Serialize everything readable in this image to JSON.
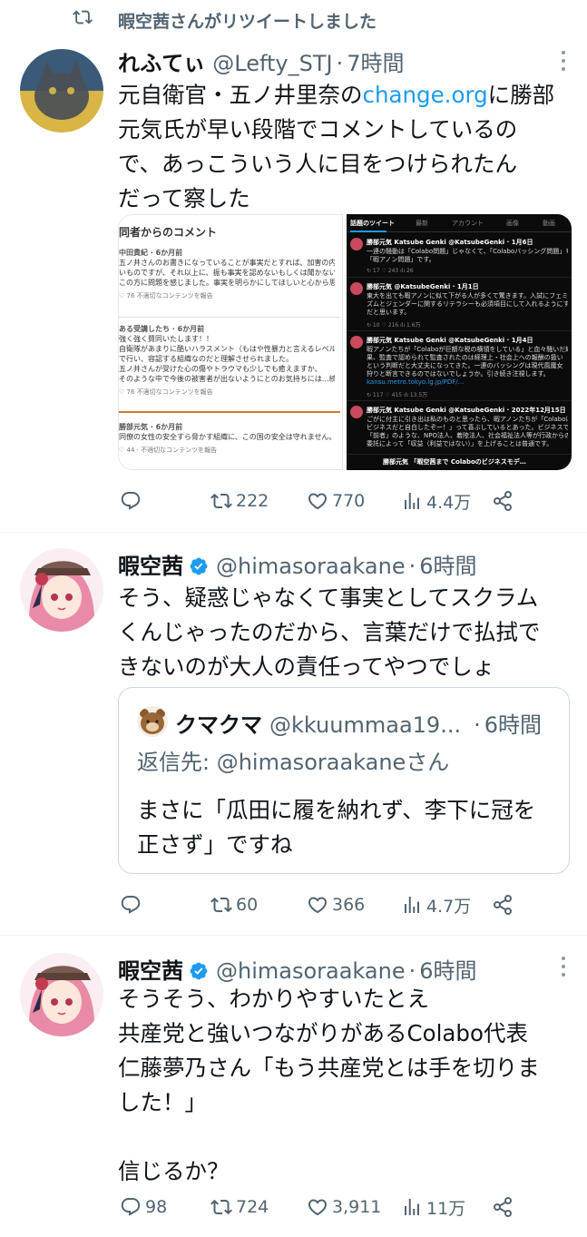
{
  "retweet_banner": {
    "text": "暇空茜さんがリツイートしました"
  },
  "tweets": [
    {
      "name": "れふてぃ",
      "handle": "@Lefty_STJ",
      "separator": "·",
      "time": "7時間",
      "text_before_link": "元自衛官・五ノ井里奈の",
      "link": "change.org",
      "text_after_link": "に勝部\n元気氏が早い段階でコメントしているの\nで、あっこういう人に目をつけられたん\nだって察した",
      "media": {
        "left": {
          "title": "同者からのコメント",
          "comments": [
            {
              "author": "中田貴紀 · 6か月前",
              "lines": [
                "五ノ井さんのお書きになっていることが事実だとすれば、加害の内容もひど",
                "いものですが、それ以上に、振も事実を認めないもしくは聞かないという",
                "この方に問題を感じました。事実を明らかにしてほしいと心から思います。"
              ],
              "meta": "♡ 76   不適切なコンテンツを報告"
            },
            {
              "author": "ある受講したち · 6か月前",
              "lines": [
                "強く強く賛同いたします！！",
                "自衛隊があまりに酷いハラスメント（もはや性暴力と言えるレベル）を平気",
                "で行い、容認する組織なのだと理解させられました。",
                "五ノ井さんが受けた心の傷やトラウマも少しでも癒えますか、",
                "そのような中で今後の被害者が出ないようにとのお気持ちには…続きを読む"
              ],
              "meta": "♡ 76   不適切なコンテンツを報告"
            },
            {
              "author": "勝部元気 · 6か月前",
              "lines": [
                "同僚の女性の安全すら脅かす組織に、この国の安全は守れません。"
              ],
              "meta": "♡ 44 · 不適切なコンテンツを報告"
            }
          ]
        },
        "right": {
          "tabs": [
            "話題のツイート",
            "最新",
            "アカウント",
            "画像",
            "動画"
          ],
          "items": [
            {
              "head": "勝部元気 Katsube Genki @KatsubeGenki · 1月6日",
              "lines": [
                "一連の騒動は「Colabo問題」じゃなくて、「Colaboバッシング問題」もしくは",
                "「暇アノン問題」です。"
              ],
              "stats": "↻ 17   ♡ 243   ılı 26"
            },
            {
              "head": "勝部元気 @KatsubeGenki · 1月1日",
              "lines": [
                "東大を出ても暇アノンに似て下がる人が多くて驚きます。入試にフェミニ",
                "ズムとジェンダーに関するリテラシーも必須項目にして入れるようにするべき",
                "だと思います。"
              ],
              "stats": "↻ 10   ♡ 216   ılı 1.6万"
            },
            {
              "head": "勝部元気 Katsube Genki @KatsubeGenki · 1月4日",
              "lines": [
                "暇アノンたちが「Colaboが巨額な税の横領をしている」と血々騒いだ結",
                "果、監査で認められて監査されたのは経理上・社会上への報酬の扱い",
                "という判断だと大丈夫になってきた。一連のバッシングは現代風魔女",
                "狩りと断言できるのではないでしょうか。引き続き注視します。",
                "kansu.metro.tokyo.lg.jp/PDF/..."
              ],
              "stats": "↻ 117   ♡ 415   ılı 13.5万"
            },
            {
              "head": "勝部元気 Katsube Genki @KatsubeGenki · 2022年12月15日",
              "lines": [
                "ごがに付主に引き出は私のものと思ったら、暇アノンたちが「Colaboは横領",
                "ビジネスだと自白したぞー！」って喜ぶしているとあった。ビジネスでは",
                "「前者」のような、NPO法人、着陸法人、社会福祉法人等が行政からの",
                "委託によって「収益（利益ではない）」を上げることは普通です。"
              ],
              "stats": ""
            },
            {
              "head": "勝部元気 「暇空茜まで Colaboのビジネスモデ…",
              "lines": [],
              "stats": ""
            }
          ]
        }
      },
      "actions": {
        "reply": "",
        "retweet": "222",
        "like": "770",
        "views": "4.4万"
      }
    },
    {
      "name": "暇空茜",
      "handle": "@himasoraakane",
      "separator": "·",
      "time": "6時間",
      "text": "そう、疑惑じゃなくて事実としてスクラム\nくんじゃったのだから、言葉だけで払拭で\nきないのが大人の責任ってやつでしょ",
      "quote": {
        "name": "クマクマ",
        "handle": "@kkuummaa19...",
        "separator": "·",
        "time": "6時間",
        "reply_prefix": "返信先: ",
        "reply_mention": "@himasoraakane",
        "reply_suffix": "さん",
        "text": "まさに「瓜田に履を納れず、李下に冠を\n正さず」ですね"
      },
      "actions": {
        "reply": "",
        "retweet": "60",
        "like": "366",
        "views": "4.7万"
      }
    },
    {
      "name": "暇空茜",
      "handle": "@himasoraakane",
      "separator": "·",
      "time": "6時間",
      "text": "そうそう、わかりやすいたとえ\n共産党と強いつながりがあるColabo代表\n仁藤夢乃さん「もう共産党とは手を切りま\nした！」\n\n信じるか？",
      "actions": {
        "reply": "98",
        "retweet": "724",
        "like": "3,911",
        "views": "11万"
      }
    }
  ],
  "icons": {
    "retweet": "retweet-icon",
    "reply": "reply-icon",
    "like": "heart-icon",
    "views": "views-icon",
    "share": "share-icon",
    "verified": "verified-badge-icon",
    "more": "more-options-icon"
  },
  "colors": {
    "link": "#1d9bf0",
    "secondary_text": "#536471",
    "verified": "#1d9bf0",
    "divider": "#eff3f4"
  }
}
